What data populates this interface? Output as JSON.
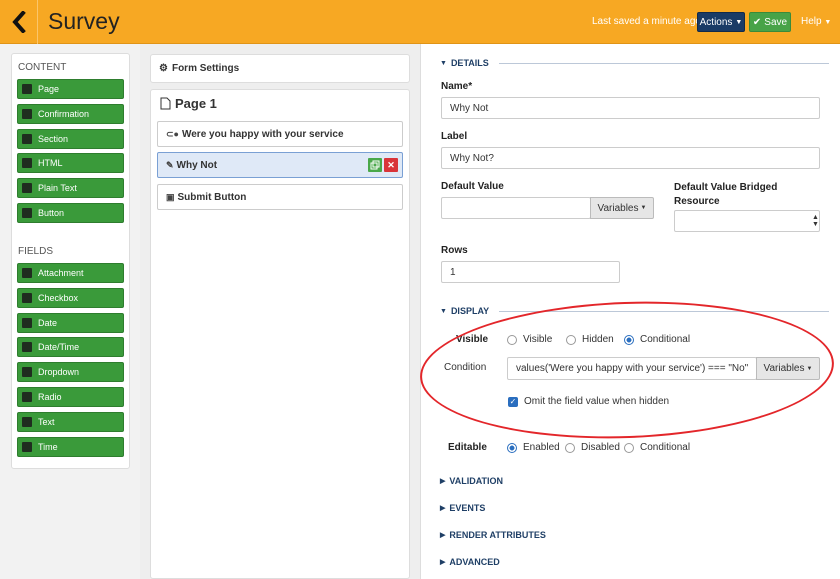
{
  "header": {
    "title": "Survey",
    "last_saved": "Last saved a minute ago",
    "actions_label": "Actions",
    "save_label": "Save",
    "help_label": "Help"
  },
  "palette": {
    "content_heading": "CONTENT",
    "content_items": [
      {
        "label": "Page",
        "icon": "file-icon"
      },
      {
        "label": "Confirmation",
        "icon": "confirmation-icon"
      },
      {
        "label": "Section",
        "icon": "section-icon"
      },
      {
        "label": "HTML",
        "icon": "html-icon"
      },
      {
        "label": "Plain Text",
        "icon": "text-icon"
      },
      {
        "label": "Button",
        "icon": "play-icon"
      }
    ],
    "fields_heading": "FIELDS",
    "field_items": [
      {
        "label": "Attachment",
        "icon": "paperclip-icon"
      },
      {
        "label": "Checkbox",
        "icon": "checkbox-icon"
      },
      {
        "label": "Date",
        "icon": "calendar-icon"
      },
      {
        "label": "Date/Time",
        "icon": "calendar-clock-icon"
      },
      {
        "label": "Dropdown",
        "icon": "list-icon"
      },
      {
        "label": "Radio",
        "icon": "radio-icon"
      },
      {
        "label": "Text",
        "icon": "pencil-icon"
      },
      {
        "label": "Time",
        "icon": "clock-icon"
      }
    ]
  },
  "form": {
    "settings_label": "Form Settings",
    "page_title": "Page 1",
    "fields": [
      {
        "label": "Were you happy with your service",
        "icon": "toggle-icon"
      },
      {
        "label": "Why Not",
        "icon": "edit-icon"
      },
      {
        "label": "Submit Button",
        "icon": "play-icon"
      }
    ]
  },
  "details": {
    "heading": "DETAILS",
    "name_label": "Name*",
    "name_value": "Why Not",
    "label_label": "Label",
    "label_value": "Why Not?",
    "default_value_label": "Default Value",
    "default_value_value": "",
    "variables_label": "Variables",
    "bridged_label": "Default Value Bridged Resource",
    "rows_label": "Rows",
    "rows_value": "1"
  },
  "display": {
    "heading": "DISPLAY",
    "visible_label": "Visible",
    "visible_options": [
      "Visible",
      "Hidden",
      "Conditional"
    ],
    "visible_selected": "Conditional",
    "condition_label": "Condition",
    "condition_value": "values('Were you happy with your service') === \"No\"",
    "variables_label": "Variables",
    "omit_label": "Omit the field value when hidden",
    "omit_checked": true,
    "editable_label": "Editable",
    "editable_options": [
      "Enabled",
      "Disabled",
      "Conditional"
    ],
    "editable_selected": "Enabled"
  },
  "sections": {
    "validation": "VALIDATION",
    "events": "EVENTS",
    "render_attributes": "RENDER ATTRIBUTES",
    "advanced": "ADVANCED"
  },
  "colors": {
    "header_bg": "#f7a823",
    "palette_green": "#3a9a3a",
    "actions_bg": "#1a3b66",
    "save_bg": "#48a348",
    "annotation_red": "#e3262a",
    "section_blue": "#1f3f66"
  }
}
